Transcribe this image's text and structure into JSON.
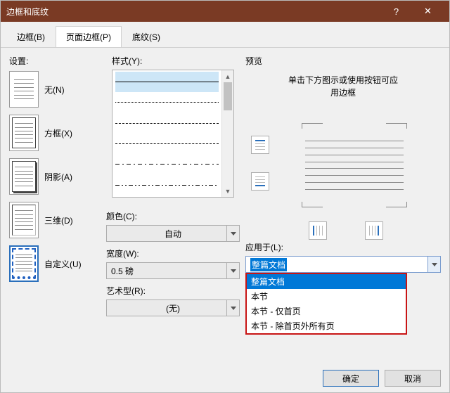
{
  "window": {
    "title": "边框和底纹"
  },
  "tabs": {
    "border": "边框(B)",
    "page_border": "页面边框(P)",
    "shading": "底纹(S)"
  },
  "settings": {
    "label": "设置:",
    "none": "无(N)",
    "box": "方框(X)",
    "shadow": "阴影(A)",
    "threeD": "三维(D)",
    "custom": "自定义(U)"
  },
  "style": {
    "label": "样式(Y):",
    "color_label": "颜色(C):",
    "color_value": "自动",
    "width_label": "宽度(W):",
    "width_value": "0.5 磅",
    "art_label": "艺术型(R):",
    "art_value": "(无)"
  },
  "preview": {
    "label": "预览",
    "hint_line1": "单击下方图示或使用按钮可应",
    "hint_line2": "用边框"
  },
  "apply": {
    "label": "应用于(L):",
    "value": "整篇文档",
    "options": [
      "整篇文档",
      "本节",
      "本节 - 仅首页",
      "本节 - 除首页外所有页"
    ]
  },
  "footer": {
    "ok": "确定",
    "cancel": "取消"
  }
}
